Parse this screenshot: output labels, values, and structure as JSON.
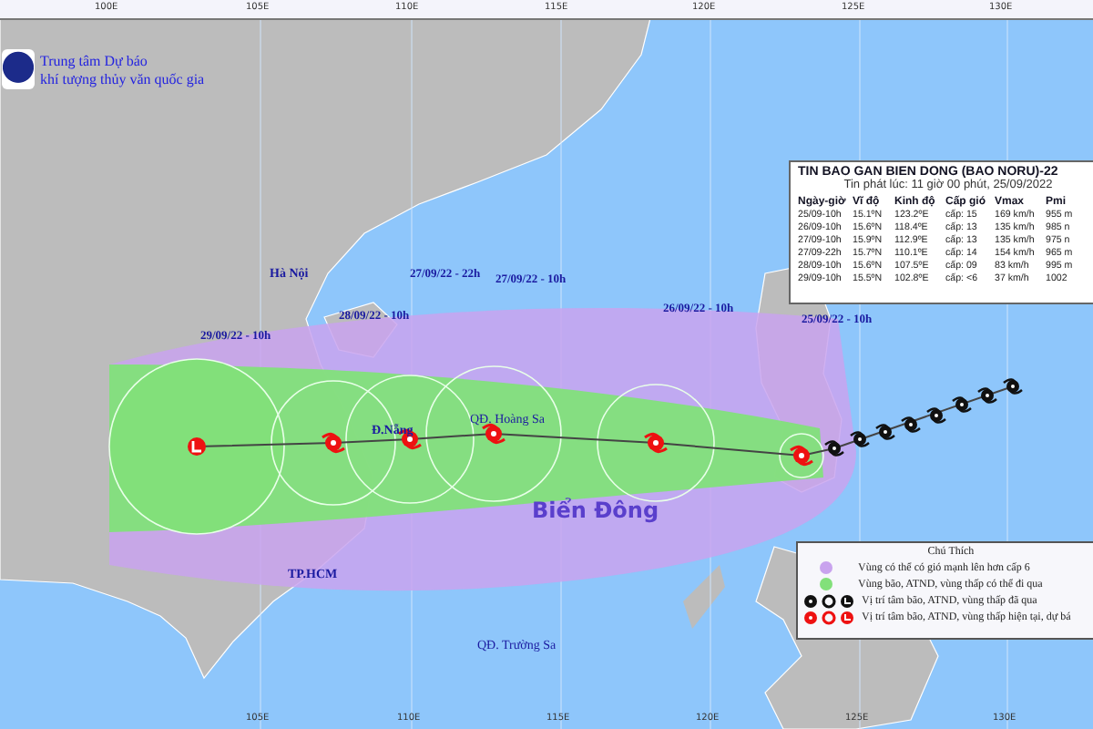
{
  "agency": {
    "lines": [
      "Trung tâm Dự báo",
      "khí tượng thủy văn quốc gia"
    ]
  },
  "axis_top": [
    "100E",
    "105E",
    "110E",
    "115E",
    "120E",
    "125E",
    "130E"
  ],
  "axis_bottom": [
    "105E",
    "110E",
    "115E",
    "120E",
    "125E",
    "130E"
  ],
  "places": [
    {
      "kind": "city",
      "label": "Hà Nội"
    },
    {
      "kind": "city",
      "label": "Đ.Nẵng"
    },
    {
      "kind": "island",
      "label": "QĐ. Hoàng Sa"
    },
    {
      "kind": "sea",
      "label": "Biển Đông"
    },
    {
      "kind": "city",
      "label": "TP.HCM"
    },
    {
      "kind": "island",
      "label": "QĐ. Trường Sa"
    }
  ],
  "time_labels": [
    "29/09/22 - 10h",
    "28/09/22 - 10h",
    "27/09/22 - 22h",
    "27/09/22 - 10h",
    "26/09/22 - 10h",
    "25/09/22 - 10h"
  ],
  "bulletin": {
    "title": "TIN BAO GAN BIEN DONG (BAO NORU)-22",
    "issued": "Tin phát lúc: 11 giờ 00 phút, 25/09/2022",
    "columns": [
      "Ngày-giờ",
      "Vĩ độ",
      "Kinh độ",
      "Cấp gió",
      "Vmax",
      "Pmi"
    ],
    "rows": [
      [
        "25/09-10h",
        "15.1ºN",
        "123.2ºE",
        "cấp: 15",
        "169 km/h",
        "955 m"
      ],
      [
        "26/09-10h",
        "15.6ºN",
        "118.4ºE",
        "cấp: 13",
        "135 km/h",
        "985 n"
      ],
      [
        "27/09-10h",
        "15.9ºN",
        "112.9ºE",
        "cấp: 13",
        "135 km/h",
        "975 n"
      ],
      [
        "27/09-22h",
        "15.7ºN",
        "110.1ºE",
        "cấp: 14",
        "154 km/h",
        "965 m"
      ],
      [
        "28/09-10h",
        "15.6ºN",
        "107.5ºE",
        "cấp: 09",
        "83 km/h",
        "995 m"
      ],
      [
        "29/09-10h",
        "15.5ºN",
        "102.8ºE",
        "cấp: <6",
        "37 km/h",
        "1002"
      ]
    ]
  },
  "legend": {
    "title": "Chú Thích",
    "items": [
      {
        "kind": "swatch",
        "color": "#c9a3ee",
        "label": "Vùng có thể có gió mạnh lên hơn cấp 6"
      },
      {
        "kind": "swatch",
        "color": "#82e07a",
        "label": "Vùng bão, ATND, vùng thấp có thể đi qua"
      },
      {
        "kind": "symbols",
        "color": "#111111",
        "label": "Vị trí tâm bão, ATND, vùng thấp đã qua"
      },
      {
        "kind": "symbols",
        "color": "#ee1111",
        "label": "Vị trí tâm bão, ATND, vùng thấp hiện tại, dự bá"
      }
    ]
  }
}
